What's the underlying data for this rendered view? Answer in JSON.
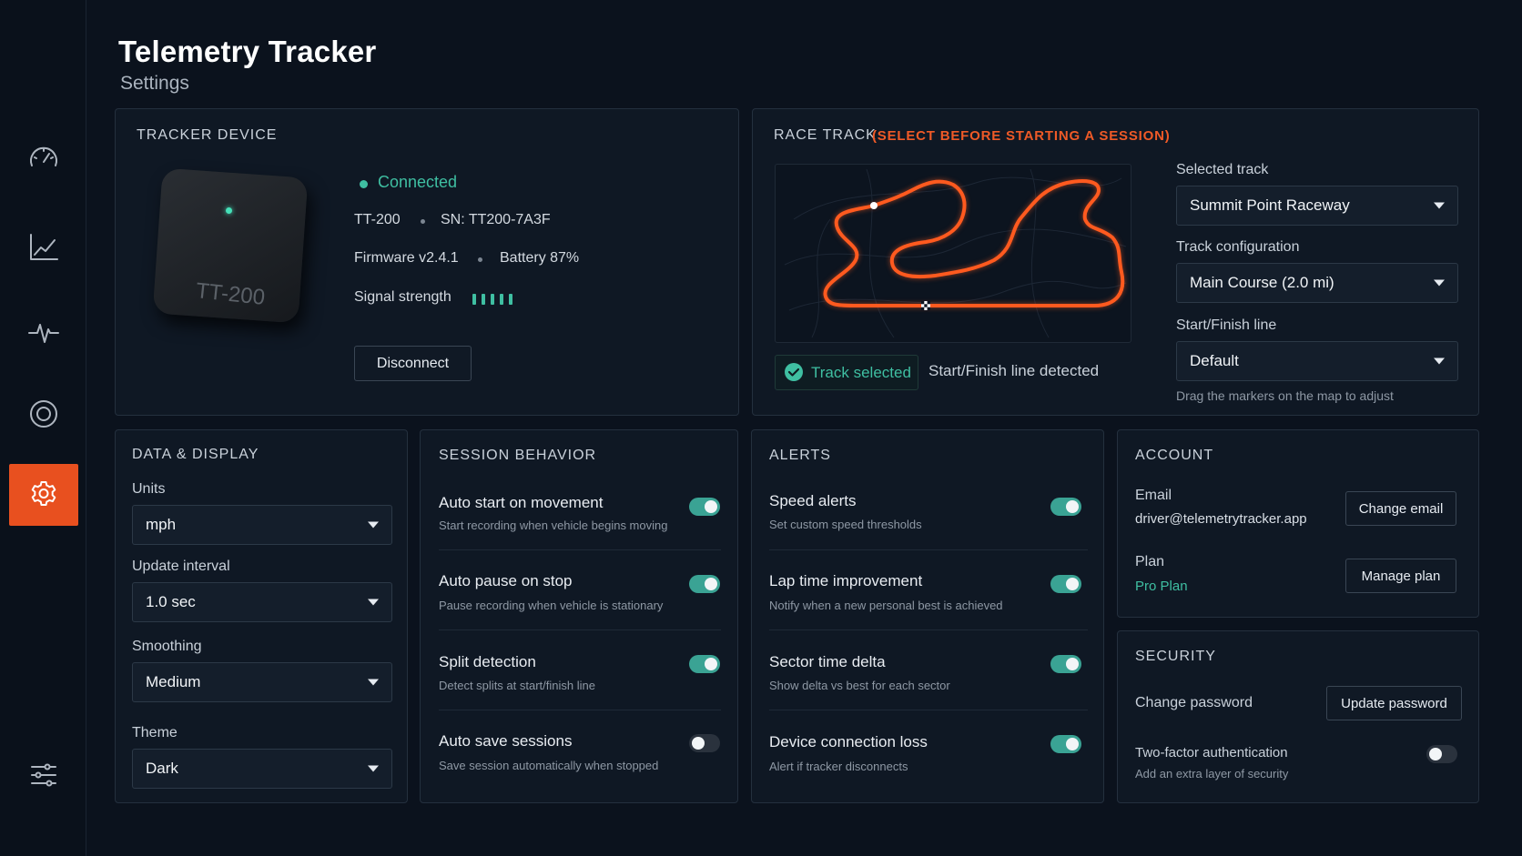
{
  "app": {
    "title": "Telemetry Tracker",
    "subtitle": "Settings"
  },
  "colors": {
    "accent": "#e8501f",
    "success": "#3fbfa2",
    "toggle_on": "#3aa394"
  },
  "sidebar": {
    "items": [
      {
        "icon": "speedometer-icon",
        "active": false
      },
      {
        "icon": "line-chart-icon",
        "active": false
      },
      {
        "icon": "pulse-icon",
        "active": false
      },
      {
        "icon": "target-icon",
        "active": false
      },
      {
        "icon": "gear-icon",
        "active": true
      },
      {
        "icon": "sliders-icon",
        "active": false
      }
    ]
  },
  "tracker": {
    "title": "TRACKER DEVICE",
    "device_label": "TT-200",
    "status": "Connected",
    "model": "TT-200",
    "serial": "SN: TT200-7A3F",
    "firmware": "Firmware v2.4.1",
    "battery": "Battery 87%",
    "signal_label": "Signal strength",
    "signal_bars": 5,
    "disconnect_label": "Disconnect"
  },
  "race_track": {
    "title": "RACE TRACK",
    "warning": "(SELECT BEFORE STARTING A SESSION)",
    "selected_badge": "Track selected",
    "line_status": "Start/Finish line detected",
    "selected_track_label": "Selected track",
    "selected_track_value": "Summit Point Raceway",
    "config_label": "Track configuration",
    "config_value": "Main Course (2.0 mi)",
    "sf_label": "Start/Finish line",
    "sf_value": "Default",
    "hint": "Drag the markers on the map to adjust"
  },
  "data_display": {
    "title": "DATA & DISPLAY",
    "fields": [
      {
        "label": "Units",
        "value": "mph"
      },
      {
        "label": "Update interval",
        "value": "1.0 sec"
      },
      {
        "label": "Smoothing",
        "value": "Medium"
      },
      {
        "label": "Theme",
        "value": "Dark"
      }
    ]
  },
  "session": {
    "title": "SESSION BEHAVIOR",
    "items": [
      {
        "label": "Auto start on movement",
        "desc": "Start recording when vehicle begins moving",
        "on": true
      },
      {
        "label": "Auto pause on stop",
        "desc": "Pause recording when vehicle is stationary",
        "on": true
      },
      {
        "label": "Split detection",
        "desc": "Detect splits at start/finish line",
        "on": true
      },
      {
        "label": "Auto save sessions",
        "desc": "Save session automatically when stopped",
        "on": false
      }
    ]
  },
  "alerts": {
    "title": "ALERTS",
    "items": [
      {
        "label": "Speed alerts",
        "desc": "Set custom speed thresholds",
        "on": true
      },
      {
        "label": "Lap time improvement",
        "desc": "Notify when a new personal best is achieved",
        "on": true
      },
      {
        "label": "Sector time delta",
        "desc": "Show delta vs best for each sector",
        "on": true
      },
      {
        "label": "Device connection loss",
        "desc": "Alert if tracker disconnects",
        "on": true
      }
    ]
  },
  "account": {
    "title": "ACCOUNT",
    "email_label": "Email",
    "email_value": "driver@telemetrytracker.app",
    "change_email": "Change email",
    "plan_label": "Plan",
    "plan_value": "Pro Plan",
    "manage_plan": "Manage plan"
  },
  "security": {
    "title": "SECURITY",
    "password_label": "Change password",
    "update_password": "Update password",
    "twofa_label": "Two-factor authentication",
    "twofa_desc": "Add an extra layer of security",
    "twofa_on": false
  }
}
